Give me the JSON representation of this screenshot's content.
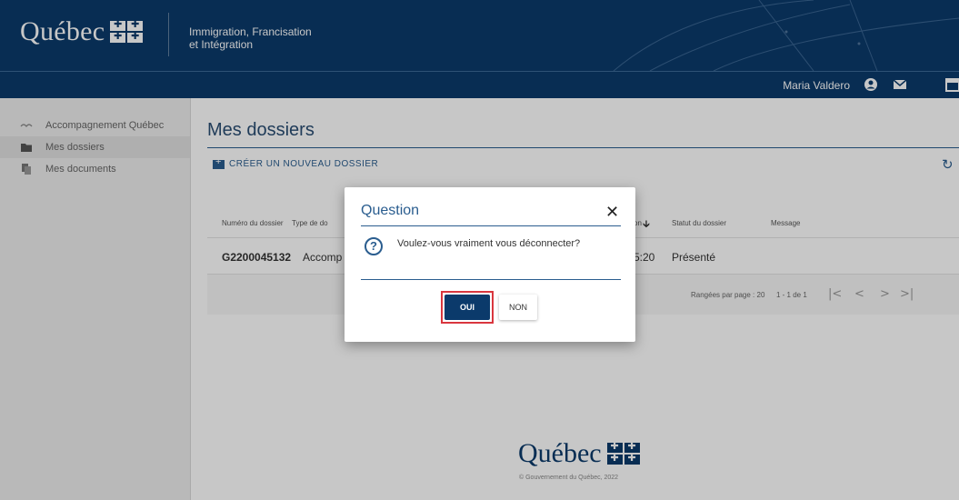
{
  "header": {
    "logo_text": "Québec",
    "ministry_line1": "Immigration, Francisation",
    "ministry_line2": "et Intégration",
    "username": "Maria Valdero",
    "icons": [
      "user-circle-icon",
      "mail-icon",
      "calendar-icon"
    ]
  },
  "sidebar": {
    "items": [
      {
        "label": "Accompagnement Québec",
        "icon": "handshake-icon"
      },
      {
        "label": "Mes dossiers",
        "icon": "folder-icon",
        "active": true
      },
      {
        "label": "Mes documents",
        "icon": "documents-icon"
      }
    ]
  },
  "main": {
    "title": "Mes dossiers",
    "create_label": "CRÉER UN NOUVEAU DOSSIER",
    "table": {
      "headers": {
        "numero": "Numéro du dossier",
        "type": "Type de do",
        "date": "on",
        "statut": "Statut du dossier",
        "message": "Message"
      },
      "sort_icon": "arrow-down-icon",
      "rows": [
        {
          "numero": "G2200045132",
          "type": "Accomp",
          "date": "5:20",
          "statut": "Présenté"
        }
      ]
    },
    "pager": {
      "rows_per_page": "Rangées par page : 20",
      "range": "1 - 1 de 1"
    }
  },
  "footer": {
    "logo_text": "Québec",
    "copyright": "© Gouvernement du Québec, 2022"
  },
  "modal": {
    "title": "Question",
    "message": "Voulez-vous vraiment vous déconnecter?",
    "oui_label": "OUI",
    "non_label": "NON"
  },
  "colors": {
    "brand": "#0b3a6b",
    "accent": "#2a5d8f",
    "highlight": "#d9363e"
  }
}
